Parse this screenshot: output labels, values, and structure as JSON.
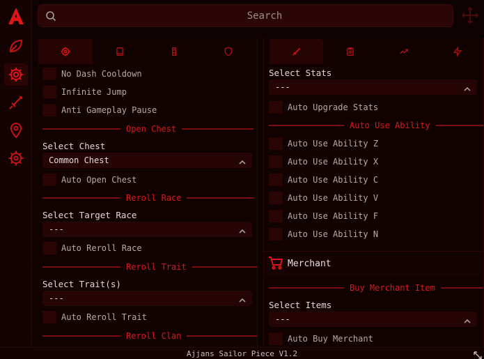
{
  "search": {
    "placeholder": "Search"
  },
  "footer": {
    "title": "Ajjans Sailor Piece V1.2"
  },
  "left_panel": {
    "toggles_top": [
      "No Dash Cooldown",
      "Infinite Jump",
      "Anti Gameplay Pause"
    ],
    "sections": {
      "open_chest": "Open Chest",
      "reroll_race": "Reroll Race",
      "reroll_trait": "Reroll Trait",
      "reroll_clan": "Reroll Clan"
    },
    "select_chest": {
      "label": "Select Chest",
      "value": "Common Chest"
    },
    "auto_open_chest": "Auto Open Chest",
    "select_race": {
      "label": "Select Target Race",
      "value": "---"
    },
    "auto_reroll_race": "Auto Reroll Race",
    "select_trait": {
      "label": "Select Trait(s)",
      "value": "---"
    },
    "auto_reroll_trait": "Auto Reroll Trait"
  },
  "right_panel": {
    "select_stats": {
      "label": "Select Stats",
      "value": "---"
    },
    "auto_upgrade_stats": "Auto Upgrade Stats",
    "sections": {
      "auto_use_ability": "Auto Use Ability",
      "buy_merchant_item": "Buy Merchant Item"
    },
    "abilities": [
      "Auto Use Ability Z",
      "Auto Use Ability X",
      "Auto Use Ability C",
      "Auto Use Ability V",
      "Auto Use Ability F",
      "Auto Use Ability N"
    ],
    "merchant_title": "Merchant",
    "select_items": {
      "label": "Select Items",
      "value": "---"
    },
    "auto_buy_merchant": "Auto Buy Merchant"
  },
  "colors": {
    "accent": "#e01515",
    "background": "#0e0101",
    "control": "#2a0505"
  }
}
